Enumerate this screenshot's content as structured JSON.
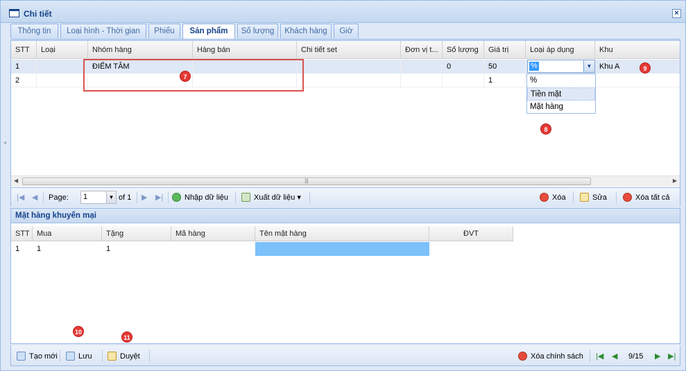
{
  "window": {
    "title": "Chi tiết"
  },
  "tabs": [
    {
      "label": "Thông tin"
    },
    {
      "label": "Loại hình - Thời gian"
    },
    {
      "label": "Phiếu"
    },
    {
      "label": "Sản phẩm"
    },
    {
      "label": "Số lượng"
    },
    {
      "label": "Khách hàng"
    },
    {
      "label": "Giờ"
    }
  ],
  "products_grid": {
    "columns": [
      "STT",
      "Loại",
      "Nhóm hàng",
      "Hàng bán",
      "Chi tiết set",
      "Đơn vị t...",
      "Số lượng",
      "Giá trị",
      "Loại áp dụng",
      "Khu"
    ],
    "rows": [
      {
        "stt": "1",
        "loai": "",
        "nhom_hang": "ĐIỂM TÂM",
        "hang_ban": "",
        "chi_tiet_set": "",
        "don_vi": "",
        "so_luong": "0",
        "gia_tri": "50",
        "loai_ap_dung": "%",
        "khu": "Khu A"
      },
      {
        "stt": "2",
        "loai": "",
        "nhom_hang": "",
        "hang_ban": "",
        "chi_tiet_set": "",
        "don_vi": "",
        "so_luong": "",
        "gia_tri": "1",
        "loai_ap_dung": "",
        "khu": ""
      }
    ],
    "apply_type_options": [
      "%",
      "Tiền mặt",
      "Mặt hàng"
    ],
    "highlighted_option": "Tiền mặt"
  },
  "pager": {
    "page_label": "Page:",
    "page_value": "1",
    "of_label": "of 1",
    "import_label": "Nhập dữ liệu",
    "export_label": "Xuất dữ liệu",
    "delete_label": "Xóa",
    "edit_label": "Sửa",
    "delete_all_label": "Xóa tất cả"
  },
  "promo_panel": {
    "title": "Mặt hàng khuyến mại",
    "columns": [
      "STT",
      "Mua",
      "Tặng",
      "Mã hàng",
      "Tên mặt hàng",
      "ĐVT"
    ],
    "rows": [
      {
        "stt": "1",
        "mua": "1",
        "tang": "1",
        "ma_hang": "",
        "ten_mat_hang": "",
        "dvt": ""
      }
    ]
  },
  "footer": {
    "new_label": "Tạo mới",
    "save_label": "Lưu",
    "approve_label": "Duyệt",
    "delete_policy_label": "Xóa chính sách",
    "record_position": "9/15"
  },
  "annotations": [
    "7",
    "8",
    "9",
    "10",
    "11"
  ]
}
